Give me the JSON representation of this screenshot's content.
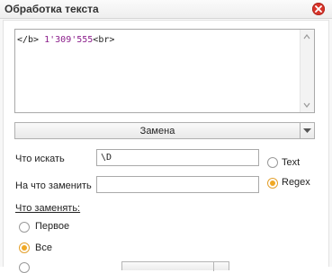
{
  "window": {
    "title": "Обработка текста"
  },
  "editor": {
    "text_before": "</b> ",
    "text_number": "1'309'555",
    "text_after": "<br>"
  },
  "operation": {
    "selected": "Замена"
  },
  "find": {
    "label": "Что искать",
    "value": "\\D",
    "mode_text_label": "Text",
    "mode_text_checked": false
  },
  "replace": {
    "label": "На что заменить",
    "value": "",
    "mode_regex_label": "Regex",
    "mode_regex_checked": true
  },
  "what_to_replace": {
    "label": "Что заменять:",
    "options": [
      {
        "label": "Первое",
        "checked": false
      },
      {
        "label": "Все",
        "checked": true
      }
    ]
  },
  "colors": {
    "accent": "#f0a824",
    "close": "#d8342a",
    "number": "#8b1e8b"
  }
}
